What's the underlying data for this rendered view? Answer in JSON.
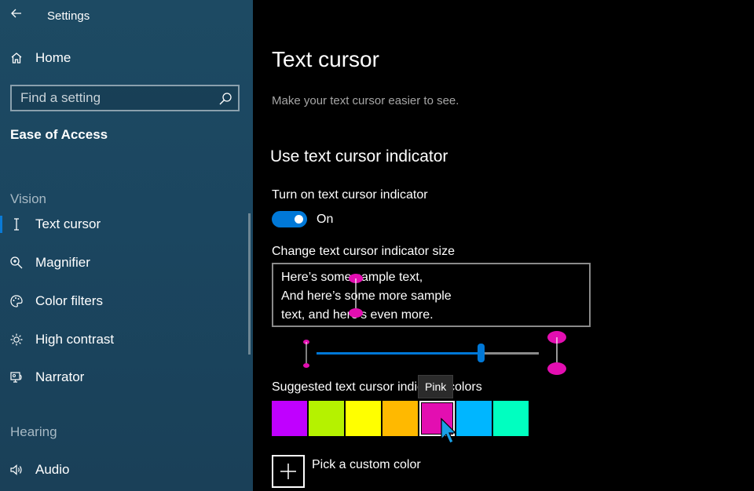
{
  "window": {
    "title": "Settings"
  },
  "sidebar": {
    "home_label": "Home",
    "search": {
      "placeholder": "Find a setting"
    },
    "section_title": "Ease of Access",
    "groups": {
      "vision": "Vision",
      "hearing": "Hearing"
    },
    "items": [
      {
        "label": "Text cursor",
        "icon": "text-cursor-icon",
        "active": true
      },
      {
        "label": "Magnifier",
        "icon": "magnifier-icon",
        "active": false
      },
      {
        "label": "Color filters",
        "icon": "color-filters-icon",
        "active": false
      },
      {
        "label": "High contrast",
        "icon": "high-contrast-icon",
        "active": false
      },
      {
        "label": "Narrator",
        "icon": "narrator-icon",
        "active": false
      },
      {
        "label": "Audio",
        "icon": "audio-icon",
        "active": false
      }
    ]
  },
  "main": {
    "title": "Text cursor",
    "description": "Make your text cursor easier to see.",
    "indicator_heading": "Use text cursor indicator",
    "toggle_label": "Turn on text cursor indicator",
    "toggle_state": "On",
    "toggle_on": true,
    "size_label": "Change text cursor indicator size",
    "sample_text": [
      "Here’s some sample text,",
      "And here’s some more sample",
      "text, and here’s even more."
    ],
    "size_level": 0.74,
    "colors_label": "Suggested text cursor indicator colors",
    "colors": [
      {
        "name": "Purple",
        "hex": "#c000ff"
      },
      {
        "name": "Lime",
        "hex": "#b5f200"
      },
      {
        "name": "Yellow",
        "hex": "#ffff00"
      },
      {
        "name": "Orange",
        "hex": "#ffb900"
      },
      {
        "name": "Pink",
        "hex": "#e30eb1"
      },
      {
        "name": "Blue",
        "hex": "#00b6ff"
      },
      {
        "name": "Teal",
        "hex": "#00ffc0"
      }
    ],
    "selected_color": "Pink",
    "tooltip": "Pink",
    "custom_color_label": "Pick a custom color"
  },
  "theme": {
    "accent": "#0078d7",
    "indicator_color": "#e30eb1"
  }
}
